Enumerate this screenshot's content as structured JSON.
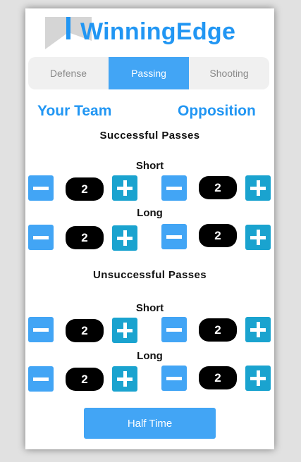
{
  "app": {
    "title": "WinningEdge"
  },
  "tabs": [
    {
      "label": "Defense",
      "active": false
    },
    {
      "label": "Passing",
      "active": true
    },
    {
      "label": "Shooting",
      "active": false
    }
  ],
  "teams": {
    "your_team": "Your Team",
    "opposition": "Opposition"
  },
  "sections": [
    {
      "title": "Successful Passes",
      "rows": [
        {
          "label": "Short",
          "your_value": "2",
          "opp_value": "2"
        },
        {
          "label": "Long",
          "your_value": "2",
          "opp_value": "2"
        }
      ]
    },
    {
      "title": "Unsuccessful Passes",
      "rows": [
        {
          "label": "Short",
          "your_value": "2",
          "opp_value": "2"
        },
        {
          "label": "Long",
          "your_value": "2",
          "opp_value": "2"
        }
      ]
    }
  ],
  "actions": {
    "half_time": "Half Time"
  },
  "colors": {
    "accent": "#2196f3",
    "tab_active": "#42a5f5",
    "minus_button": "#42a5f5",
    "plus_button": "#1aa3cf",
    "counter_bg": "#000000",
    "tabs_bg": "#f0f0f0"
  }
}
